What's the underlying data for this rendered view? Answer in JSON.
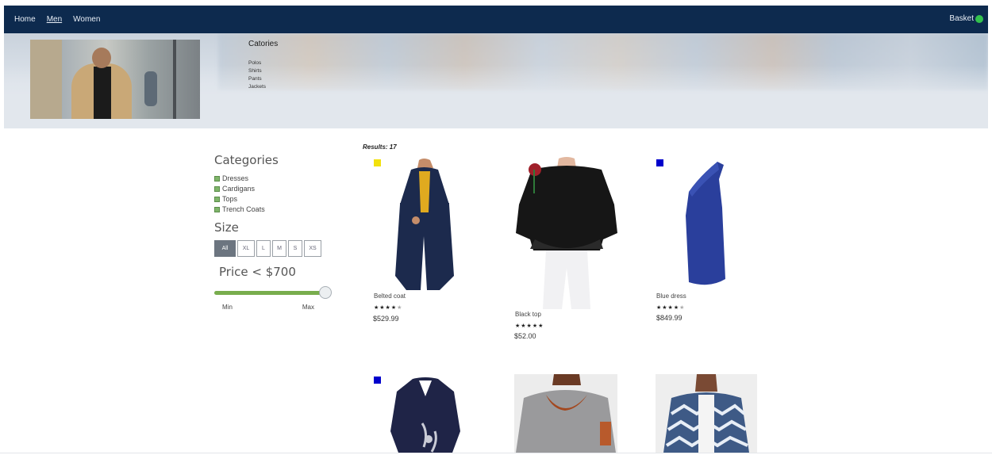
{
  "nav": {
    "items": [
      {
        "label": "Home",
        "active": false
      },
      {
        "label": "Men",
        "active": true
      },
      {
        "label": "Women",
        "active": false
      }
    ],
    "basket_label": "Basket",
    "badge_color": "#33c24d"
  },
  "banner": {
    "categories_title": "Catories",
    "categories": [
      "Polos",
      "Shirts",
      "Pants",
      "Jackets"
    ]
  },
  "sidebar": {
    "categories_title": "Categories",
    "categories": [
      "Dresses",
      "Cardigans",
      "Tops",
      "Trench Coats"
    ],
    "size_title": "Size",
    "sizes": [
      "All",
      "XL",
      "L",
      "M",
      "S",
      "XS"
    ],
    "selected_size": "All",
    "price_title": "Price < $700",
    "price_slider_fraction": 1.0,
    "min_label": "Min",
    "max_label": "Max",
    "accent_color": "#78ad4d"
  },
  "results": {
    "label": "Results: 17",
    "products": [
      {
        "name": "Belted coat",
        "rating": 4,
        "price": "$529.99",
        "swatch": "#f2e10d",
        "icon": "navy-long-coat"
      },
      {
        "name": "Black top",
        "rating": 5,
        "price": "$52.00",
        "swatch": "#000000",
        "icon": "black-blouse"
      },
      {
        "name": "Blue dress",
        "rating": 4,
        "price": "$849.99",
        "swatch": "#0000cc",
        "icon": "blue-dress"
      },
      {
        "name": "",
        "rating": 0,
        "price": "",
        "swatch": "#0000cc",
        "icon": "navy-printed-dress"
      },
      {
        "name": "",
        "rating": 0,
        "price": "",
        "swatch": "#b03030",
        "icon": "grey-cowl-top"
      },
      {
        "name": "",
        "rating": 0,
        "price": "",
        "swatch": "#0000cc",
        "icon": "patterned-cardigan"
      }
    ]
  }
}
